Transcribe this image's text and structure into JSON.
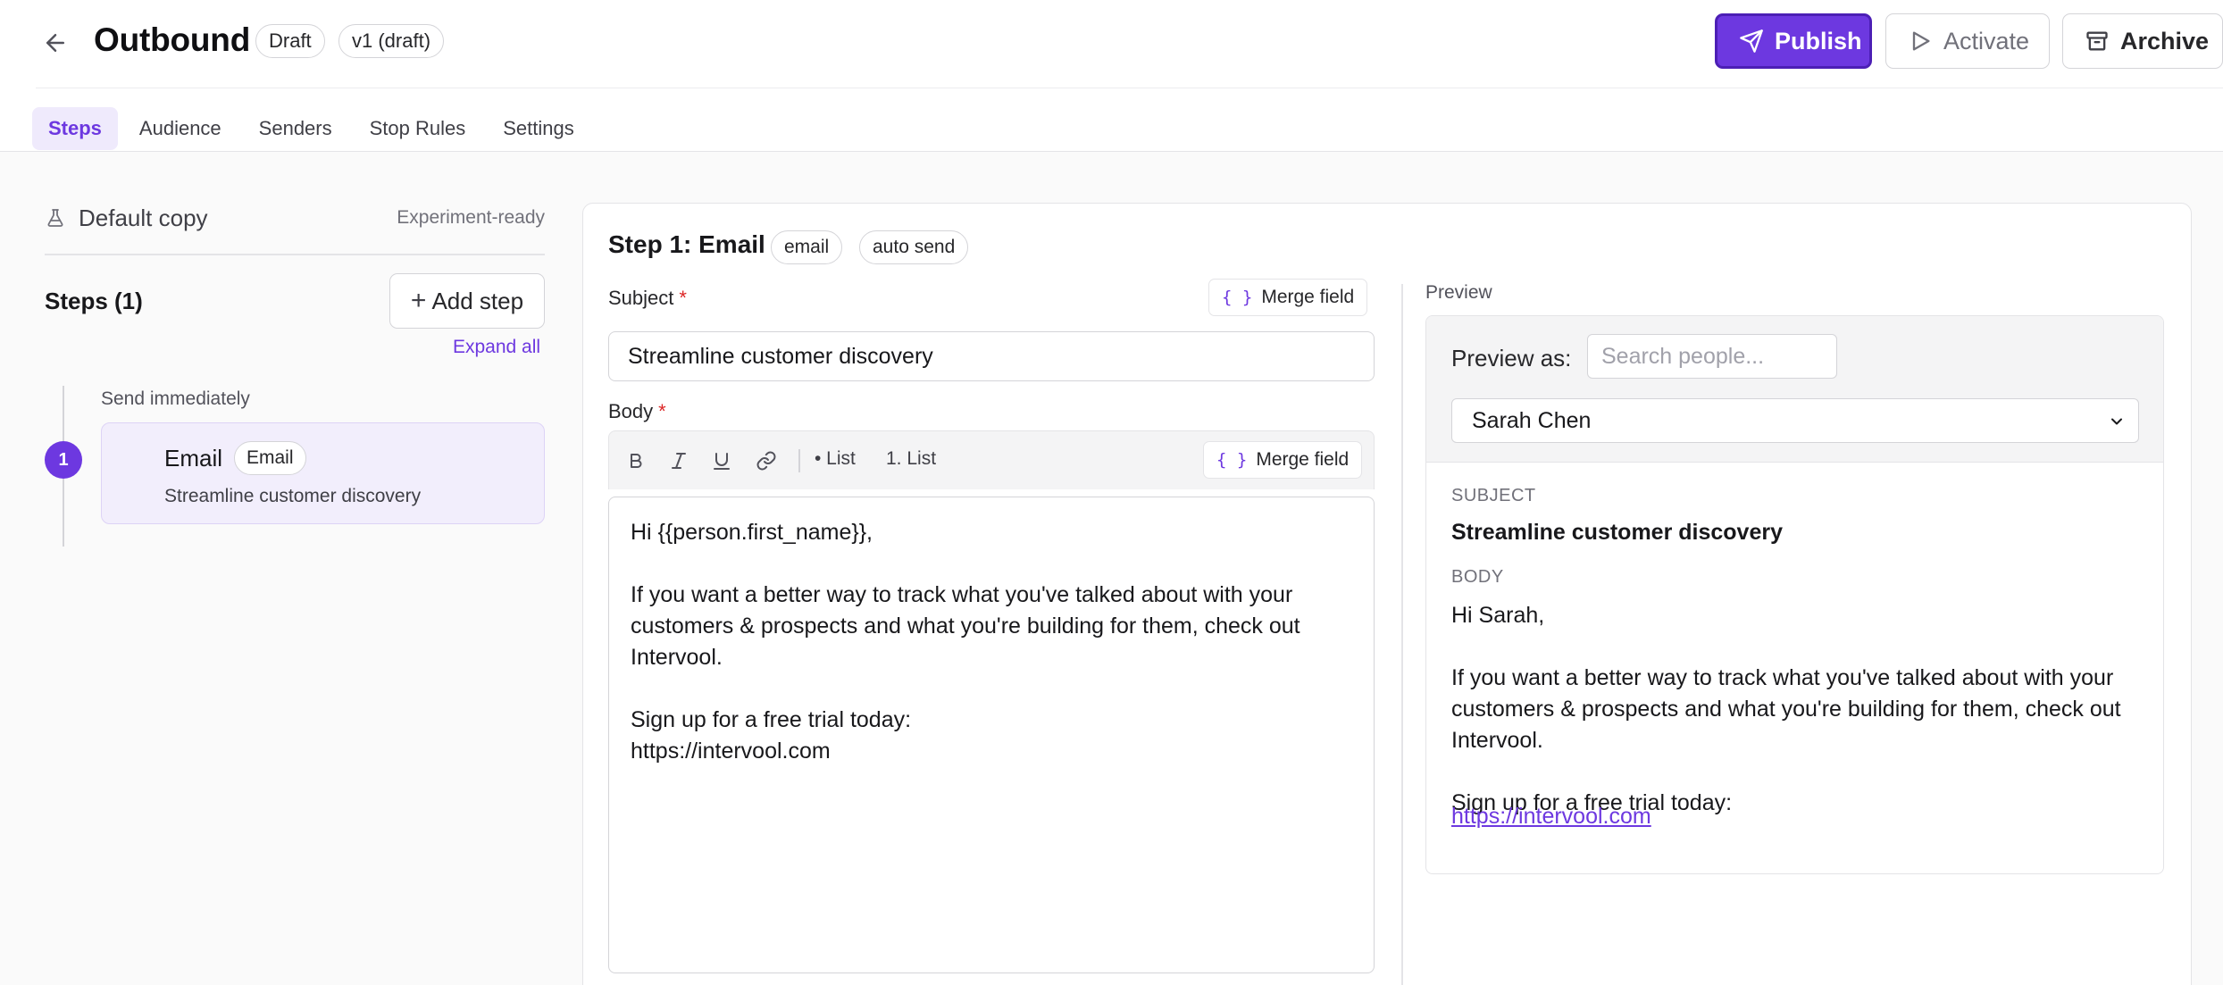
{
  "header": {
    "title": "Outbound",
    "status_badge": "Draft",
    "version_badge": "v1 (draft)",
    "buttons": {
      "publish": "Publish",
      "activate": "Activate",
      "archive": "Archive"
    }
  },
  "tabs": [
    {
      "label": "Steps",
      "active": true
    },
    {
      "label": "Audience",
      "active": false
    },
    {
      "label": "Senders",
      "active": false
    },
    {
      "label": "Stop Rules",
      "active": false
    },
    {
      "label": "Settings",
      "active": false
    }
  ],
  "sidebar": {
    "copy_label": "Default copy",
    "copy_meta": "Experiment-ready",
    "steps_title": "Steps (1)",
    "add_step": "Add step",
    "expand_all": "Expand all",
    "steps": [
      {
        "number": "1",
        "timing": "Send immediately",
        "title": "Email",
        "badge": "Email",
        "subtitle": "Streamline customer discovery"
      }
    ]
  },
  "editor": {
    "heading": "Step 1: Email",
    "tags": [
      "email",
      "auto send"
    ],
    "subject_label": "Subject",
    "subject_value": "Streamline customer discovery",
    "body_label": "Body",
    "required_mark": "*",
    "merge_field": "Merge field",
    "merge_braces": "{ }",
    "toolbar": {
      "bullet_list": "• List",
      "numbered_list": "1. List"
    },
    "body_text": "Hi {{person.first_name}},\n\nIf you want a better way to track what you've talked about with your customers & prospects and what you're building for them, check out Intervool.\n\nSign up for a free trial today:\nhttps://intervool.com"
  },
  "preview": {
    "label": "Preview",
    "preview_as": "Preview as:",
    "search_placeholder": "Search people...",
    "selected_person": "Sarah Chen",
    "subject_caption": "SUBJECT",
    "subject": "Streamline customer discovery",
    "body_caption": "BODY",
    "body_text": "Hi Sarah,\n\nIf you want a better way to track what you've talked about with your customers & prospects and what you're building for them, check out Intervool.\n\nSign up for a free trial today:",
    "link": "https://intervool.com"
  },
  "colors": {
    "accent": "#6d38e0",
    "accent_soft": "#efeafc",
    "required": "#dc2626"
  },
  "icons": [
    "arrow-left-icon",
    "send-icon",
    "play-icon",
    "archive-icon",
    "flask-icon",
    "plus-icon",
    "bold-icon",
    "italic-icon",
    "underline-icon",
    "link-icon",
    "chevron-down-icon"
  ]
}
